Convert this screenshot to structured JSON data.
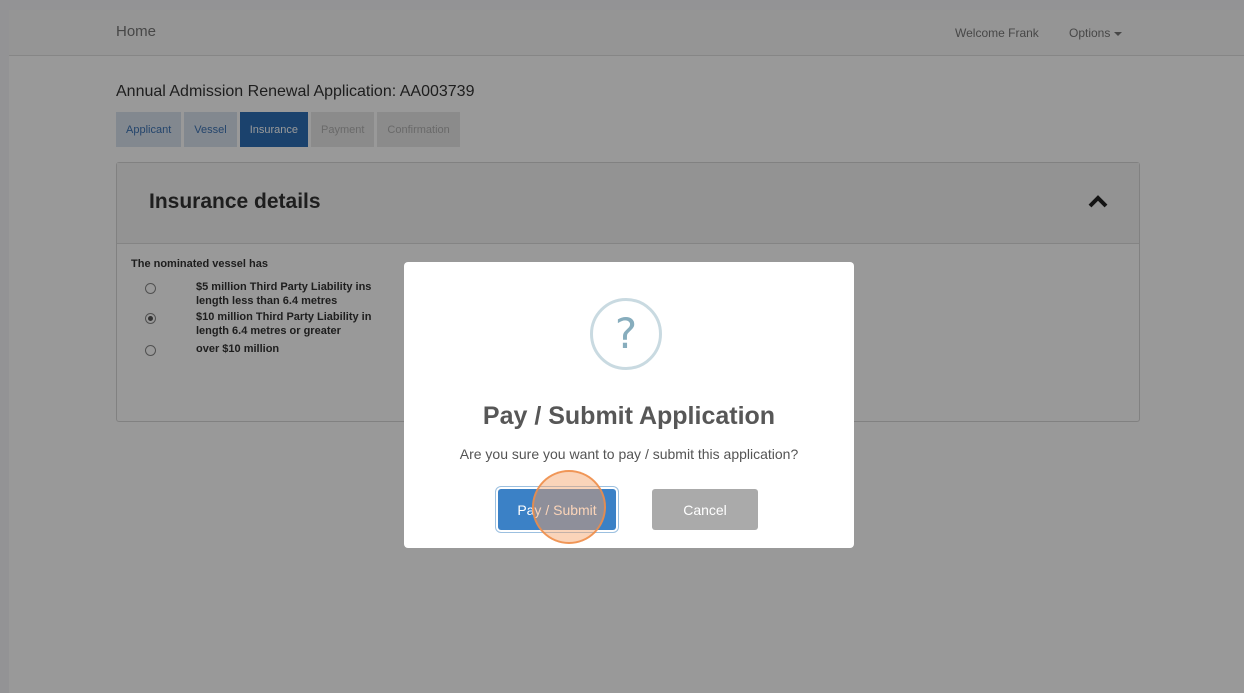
{
  "navbar": {
    "home_label": "Home",
    "welcome_text": "Welcome Frank",
    "options_label": "Options"
  },
  "page": {
    "heading": "Annual Admission Renewal Application: AA003739"
  },
  "tabs": [
    {
      "label": "Applicant",
      "state": "done"
    },
    {
      "label": "Vessel",
      "state": "done"
    },
    {
      "label": "Insurance",
      "state": "active"
    },
    {
      "label": "Payment",
      "state": "todo"
    },
    {
      "label": "Confirmation",
      "state": "todo"
    }
  ],
  "panel": {
    "title": "Insurance details",
    "collapse_icon": "chevron-up-icon",
    "question": "The nominated vessel has",
    "options": [
      {
        "line1": "$5 million Third Party Liability ins",
        "line2": "length less than 6.4 metres",
        "checked": false
      },
      {
        "line1": "$10 million Third Party Liability in",
        "line2": "length 6.4 metres or greater",
        "checked": true
      },
      {
        "line1": "over $10 million",
        "line2": "",
        "checked": false
      }
    ]
  },
  "modal": {
    "icon": "question-mark-icon",
    "icon_glyph": "?",
    "title": "Pay / Submit Application",
    "text": "Are you sure you want to pay / submit this application?",
    "confirm_label": "Pay / Submit",
    "cancel_label": "Cancel"
  },
  "colors": {
    "tab_active": "#2d6fb6",
    "confirm_button": "#3b81c6",
    "cancel_button": "#aaaaaa",
    "overlay": "rgba(0,0,0,0.4)"
  }
}
